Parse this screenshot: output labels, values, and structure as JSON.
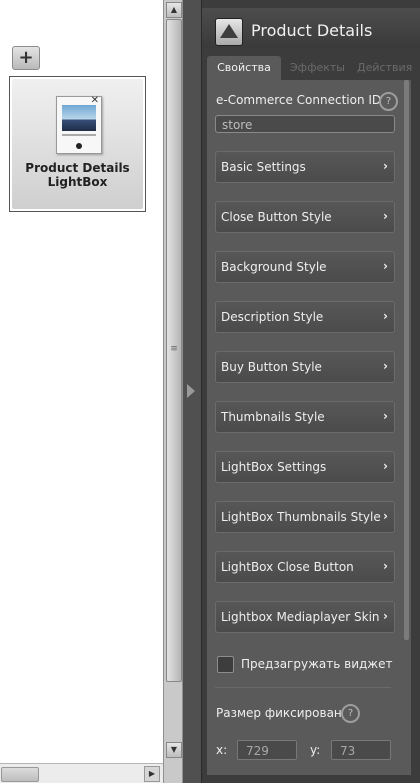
{
  "canvas": {
    "add_label": "+",
    "widget": {
      "name_line1": "Product Details",
      "name_line2": "LightBox"
    }
  },
  "panel": {
    "title": "Product Details",
    "tabs": [
      {
        "label": "Свойства",
        "active": true
      },
      {
        "label": "Эффекты",
        "active": false
      },
      {
        "label": "Действия",
        "active": false
      }
    ],
    "connection": {
      "label": "e-Commerce Connection ID",
      "value": "store",
      "help": "?"
    },
    "settings_buttons": [
      {
        "label": "Basic Settings"
      },
      {
        "label": "Close Button Style"
      },
      {
        "label": "Background Style"
      },
      {
        "label": "Description Style"
      },
      {
        "label": "Buy Button Style"
      },
      {
        "label": "Thumbnails Style"
      },
      {
        "label": "LightBox Settings"
      },
      {
        "label": "LightBox Thumbnails Style"
      },
      {
        "label": "LightBox Close Button"
      },
      {
        "label": "Lightbox Mediaplayer Skin"
      }
    ],
    "chevron": "›",
    "preload": {
      "label": "Предзагружать виджет",
      "checked": false
    },
    "size": {
      "label": "Размер фиксирован",
      "help": "?"
    },
    "coords": {
      "x_label": "x:",
      "x_value": "729",
      "y_label": "y:",
      "y_value": "73"
    }
  },
  "colors": {
    "panel_bg": "#3c3c3c",
    "content_bg": "#5a5a5a",
    "button_bg": "#525252"
  }
}
